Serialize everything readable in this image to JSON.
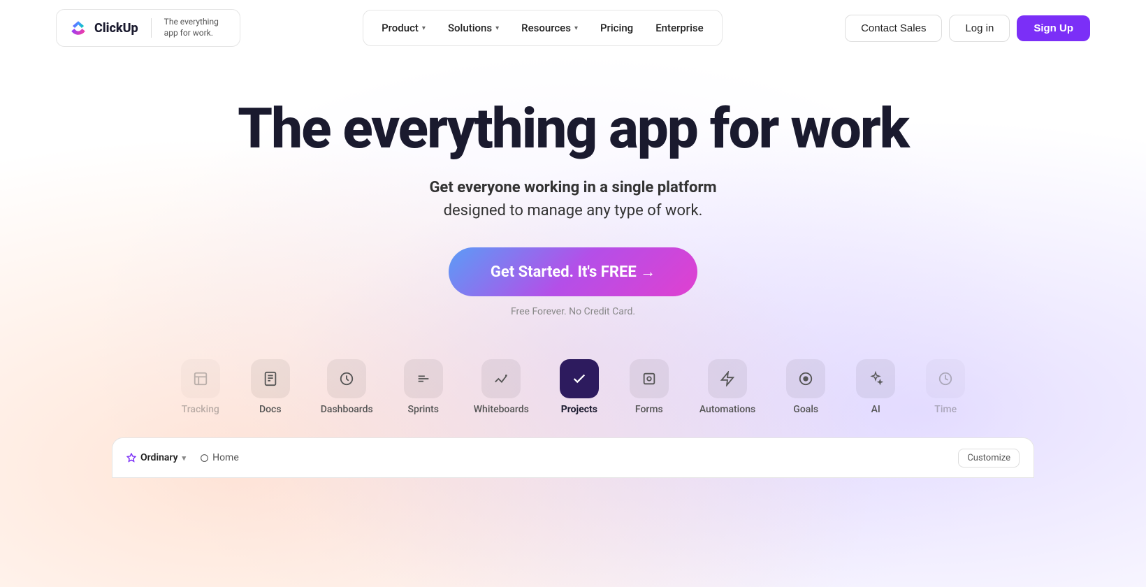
{
  "nav": {
    "logo": {
      "name": "ClickUp",
      "tagline": "The everything app for work."
    },
    "items": [
      {
        "id": "product",
        "label": "Product",
        "hasDropdown": true
      },
      {
        "id": "solutions",
        "label": "Solutions",
        "hasDropdown": true
      },
      {
        "id": "resources",
        "label": "Resources",
        "hasDropdown": true
      },
      {
        "id": "pricing",
        "label": "Pricing",
        "hasDropdown": false
      },
      {
        "id": "enterprise",
        "label": "Enterprise",
        "hasDropdown": false
      }
    ],
    "contact_sales": "Contact Sales",
    "login": "Log in",
    "signup": "Sign Up"
  },
  "hero": {
    "title": "The everything app for work",
    "subtitle_bold": "Get everyone working in a single platform",
    "subtitle_regular": "designed to manage any type of work.",
    "cta_label": "Get Started. It's FREE →",
    "note": "Free Forever. No Credit Card."
  },
  "feature_tabs": [
    {
      "id": "tracking",
      "label": "Tracking",
      "icon": "⊡",
      "active": false,
      "overflow": true
    },
    {
      "id": "docs",
      "label": "Docs",
      "icon": "📄",
      "active": false
    },
    {
      "id": "dashboards",
      "label": "Dashboards",
      "icon": "🎧",
      "active": false
    },
    {
      "id": "sprints",
      "label": "Sprints",
      "icon": "≋",
      "active": false
    },
    {
      "id": "whiteboards",
      "label": "Whiteboards",
      "icon": "✏️",
      "active": false
    },
    {
      "id": "projects",
      "label": "Projects",
      "icon": "✓",
      "active": true
    },
    {
      "id": "forms",
      "label": "Forms",
      "icon": "⊙",
      "active": false
    },
    {
      "id": "automations",
      "label": "Automations",
      "icon": "⚡",
      "active": false
    },
    {
      "id": "goals",
      "label": "Goals",
      "icon": "◎",
      "active": false
    },
    {
      "id": "ai",
      "label": "AI",
      "icon": "✦",
      "active": false
    },
    {
      "id": "time",
      "label": "Time",
      "icon": "⏱",
      "active": false,
      "overflow": true
    }
  ],
  "demo": {
    "workspace": "Ordinary",
    "home": "Home",
    "customize": "Customize"
  }
}
